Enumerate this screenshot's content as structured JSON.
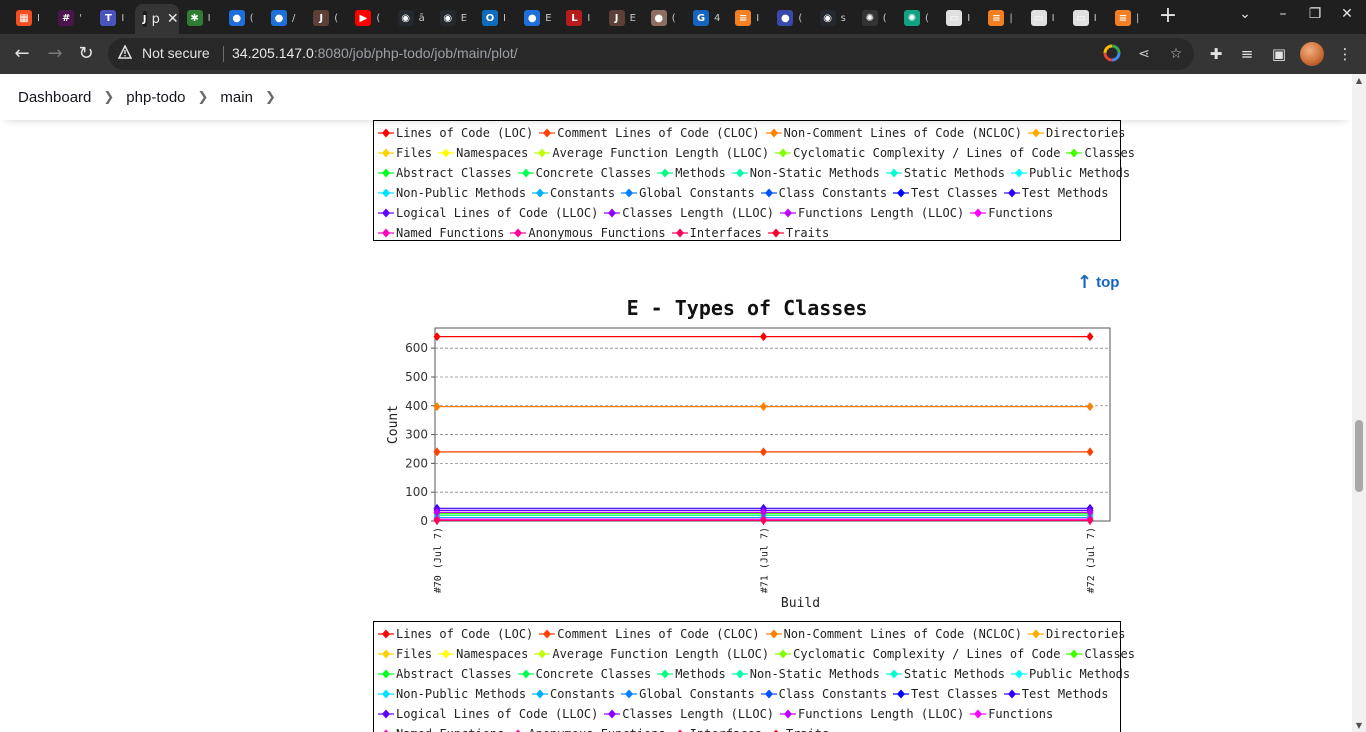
{
  "browser": {
    "tabs": [
      {
        "favicon_color": "#f25022",
        "favicon_icon": "grid-icon",
        "title": "I"
      },
      {
        "favicon_color": "#4a154b",
        "favicon_icon": "slack-icon",
        "title": "'"
      },
      {
        "favicon_color": "#4b53bc",
        "favicon_icon": "teams-icon",
        "title": "I"
      },
      {
        "favicon_color": "#1a1a1a",
        "favicon_icon": "jenkins-icon",
        "title": "p",
        "active": true
      },
      {
        "favicon_color": "#2e7d32",
        "favicon_icon": "bug-icon",
        "title": "I"
      },
      {
        "favicon_color": "#1e6fd9",
        "favicon_icon": "circle-icon",
        "title": "("
      },
      {
        "favicon_color": "#1e6fd9",
        "favicon_icon": "circle-icon",
        "title": "/"
      },
      {
        "favicon_color": "#5d4037",
        "favicon_icon": "jenkins-icon",
        "title": "("
      },
      {
        "favicon_color": "#ff0000",
        "favicon_icon": "youtube-icon",
        "title": "("
      },
      {
        "favicon_color": "#24292f",
        "favicon_icon": "github-icon",
        "title": "ā"
      },
      {
        "favicon_color": "#24292f",
        "favicon_icon": "github-icon",
        "title": "E"
      },
      {
        "favicon_color": "#0f6cbd",
        "favicon_icon": "outlook-icon",
        "title": "I"
      },
      {
        "favicon_color": "#1e6fd9",
        "favicon_icon": "circle-icon",
        "title": "E"
      },
      {
        "favicon_color": "#b71c1c",
        "favicon_icon": "laravel-icon",
        "title": "I"
      },
      {
        "favicon_color": "#5d4037",
        "favicon_icon": "jenkins-icon",
        "title": "E"
      },
      {
        "favicon_color": "#8d6e63",
        "favicon_icon": "circle-icon",
        "title": "("
      },
      {
        "favicon_color": "#1565c0",
        "favicon_icon": "g-icon",
        "title": "4"
      },
      {
        "favicon_color": "#f48024",
        "favicon_icon": "stackoverflow-icon",
        "title": "I"
      },
      {
        "favicon_color": "#3949ab",
        "favicon_icon": "circle-icon",
        "title": "("
      },
      {
        "favicon_color": "#24292f",
        "favicon_icon": "github-icon",
        "title": "s"
      },
      {
        "favicon_color": "#333333",
        "favicon_icon": "openai-icon",
        "title": "("
      },
      {
        "favicon_color": "#10a37f",
        "favicon_icon": "openai-icon",
        "title": "("
      },
      {
        "favicon_color": "#e0e0e0",
        "favicon_icon": "page-icon",
        "title": "I"
      },
      {
        "favicon_color": "#f48024",
        "favicon_icon": "stackoverflow-icon",
        "title": "|"
      },
      {
        "favicon_color": "#e0e0e0",
        "favicon_icon": "page-icon",
        "title": "I"
      },
      {
        "favicon_color": "#e0e0e0",
        "favicon_icon": "page-icon",
        "title": "I"
      },
      {
        "favicon_color": "#f48024",
        "favicon_icon": "stackoverflow-icon",
        "title": "|"
      }
    ],
    "new_tab_label": "+",
    "security_label": "Not secure",
    "url_host": "34.205.147.0",
    "url_rest": ":8080/job/php-todo/job/main/plot/"
  },
  "breadcrumb": [
    "Dashboard",
    "php-todo",
    "main"
  ],
  "top_link": "top",
  "legend_items": [
    {
      "label": "Lines of Code (LOC)",
      "color": "#ff0000"
    },
    {
      "label": "Comment Lines of Code (CLOC)",
      "color": "#ff4000"
    },
    {
      "label": "Non-Comment Lines of Code (NCLOC)",
      "color": "#ff8000"
    },
    {
      "label": "Directories",
      "color": "#ffaa00"
    },
    {
      "label": "Files",
      "color": "#ffd000"
    },
    {
      "label": "Namespaces",
      "color": "#ffff00"
    },
    {
      "label": "Average Function Length (LLOC)",
      "color": "#c0ff00"
    },
    {
      "label": "Cyclomatic Complexity / Lines of Code",
      "color": "#80ff00"
    },
    {
      "label": "Classes",
      "color": "#40ff00"
    },
    {
      "label": "Abstract Classes",
      "color": "#00ff20"
    },
    {
      "label": "Concrete Classes",
      "color": "#00ff50"
    },
    {
      "label": "Methods",
      "color": "#00ff80"
    },
    {
      "label": "Non-Static Methods",
      "color": "#00ffa8"
    },
    {
      "label": "Static Methods",
      "color": "#00ffd0"
    },
    {
      "label": "Public Methods",
      "color": "#00ffff"
    },
    {
      "label": "Non-Public Methods",
      "color": "#00e0ff"
    },
    {
      "label": "Constants",
      "color": "#00b0ff"
    },
    {
      "label": "Global Constants",
      "color": "#0080ff"
    },
    {
      "label": "Class Constants",
      "color": "#0050ff"
    },
    {
      "label": "Test Classes",
      "color": "#0000ff"
    },
    {
      "label": "Test Methods",
      "color": "#3000ff"
    },
    {
      "label": "Logical Lines of Code (LLOC)",
      "color": "#6000ff"
    },
    {
      "label": "Classes Length (LLOC)",
      "color": "#9000ff"
    },
    {
      "label": "Functions Length (LLOC)",
      "color": "#c000ff"
    },
    {
      "label": "Functions",
      "color": "#ff00ff"
    },
    {
      "label": "Named Functions",
      "color": "#ff00c0"
    },
    {
      "label": "Anonymous Functions",
      "color": "#ff0090"
    },
    {
      "label": "Interfaces",
      "color": "#ff0060"
    },
    {
      "label": "Traits",
      "color": "#ff0030"
    }
  ],
  "chart_data": {
    "type": "line",
    "title": "E - Types of Classes",
    "xlabel": "Build",
    "ylabel": "Count",
    "ylim": [
      0,
      670
    ],
    "yticks": [
      0,
      100,
      200,
      300,
      400,
      500,
      600
    ],
    "grid": true,
    "categories": [
      "#70 (Jul 7)",
      "#71 (Jul 7)",
      "#72 (Jul 7)"
    ],
    "series": [
      {
        "name": "Lines of Code (LOC)",
        "color": "#ff0000",
        "values": [
          640,
          640,
          640
        ]
      },
      {
        "name": "Comment Lines of Code (CLOC)",
        "color": "#ff4000",
        "values": [
          240,
          240,
          240
        ]
      },
      {
        "name": "Non-Comment Lines of Code (NCLOC)",
        "color": "#ff8000",
        "values": [
          397,
          397,
          397
        ]
      },
      {
        "name": "Classes",
        "color": "#40ff00",
        "values": [
          26,
          26,
          26
        ]
      },
      {
        "name": "Methods",
        "color": "#00ff80",
        "values": [
          20,
          20,
          20
        ]
      },
      {
        "name": "Constants",
        "color": "#00b0ff",
        "values": [
          12,
          12,
          12
        ]
      },
      {
        "name": "Test Methods",
        "color": "#3000ff",
        "values": [
          44,
          44,
          44
        ]
      },
      {
        "name": "Logical Lines of Code (LLOC)",
        "color": "#6000ff",
        "values": [
          37,
          37,
          37
        ]
      },
      {
        "name": "Functions Length (LLOC)",
        "color": "#c000ff",
        "values": [
          30,
          30,
          30
        ]
      },
      {
        "name": "Functions",
        "color": "#ff00ff",
        "values": [
          6,
          6,
          6
        ]
      },
      {
        "name": "Interfaces",
        "color": "#ff0060",
        "values": [
          2,
          2,
          2
        ]
      }
    ]
  }
}
